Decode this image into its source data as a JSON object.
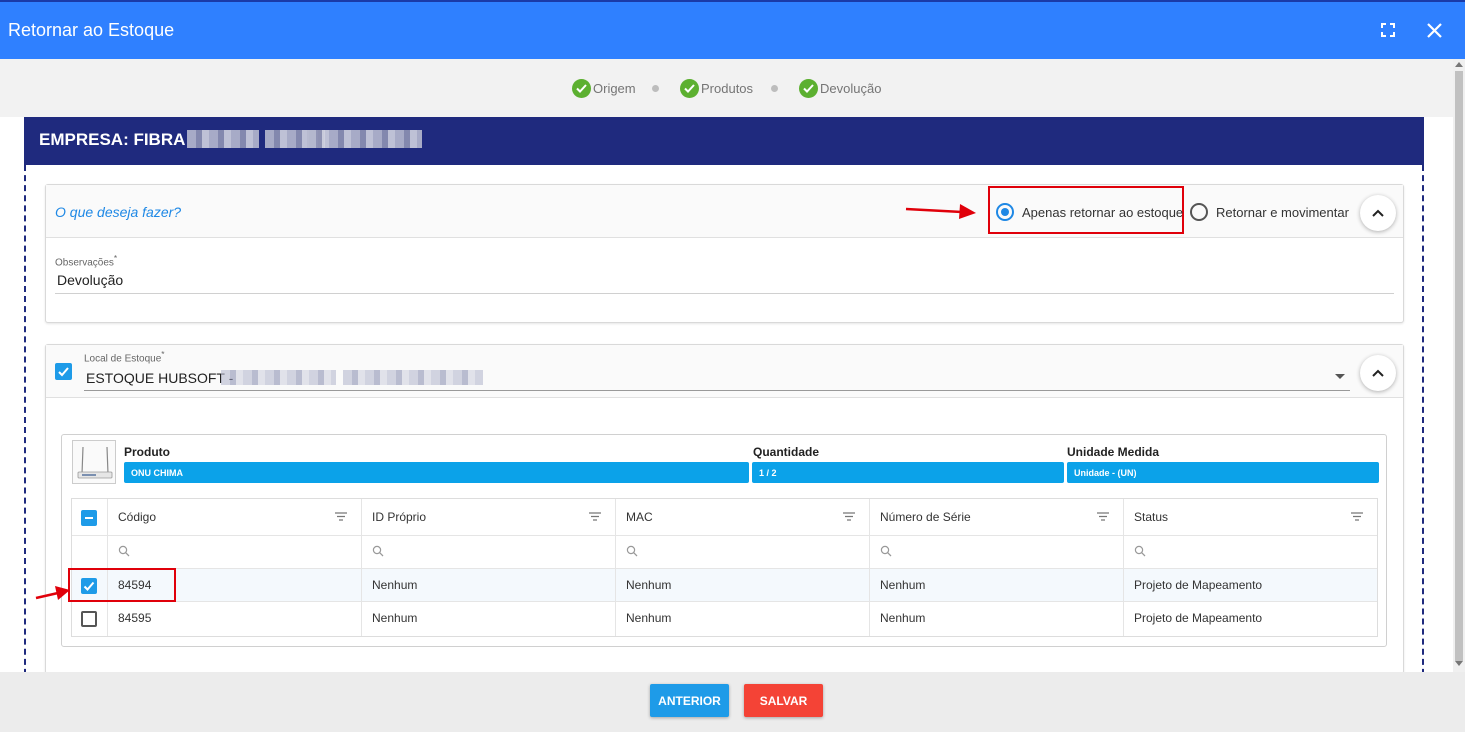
{
  "window": {
    "title": "Retornar ao Estoque",
    "accent": "#2f80ff"
  },
  "steps": [
    {
      "label": "Origem",
      "status": "done"
    },
    {
      "label": "Produtos",
      "status": "done"
    },
    {
      "label": "Devolução",
      "status": "done"
    }
  ],
  "company": {
    "label": "EMPRESA: FIBRA",
    "bar_color": "#1f2a7e"
  },
  "action_panel": {
    "question": "O que deseja fazer?",
    "options": [
      {
        "label": "Apenas retornar ao estoque",
        "selected": true
      },
      {
        "label": "Retornar e movimentar",
        "selected": false
      }
    ],
    "obs_label": "Observações",
    "obs_required": "*",
    "obs_value": "Devolução"
  },
  "stock_panel": {
    "checked": true,
    "label": "Local de Estoque",
    "required": "*",
    "value": "ESTOQUE HUBSOFT -"
  },
  "product": {
    "headers": {
      "product": "Produto",
      "qty": "Quantidade",
      "unit": "Unidade Medida"
    },
    "name": "ONU CHIMA",
    "qty": "1 / 2",
    "unit": "Unidade - (UN)"
  },
  "grid": {
    "columns": [
      "Código",
      "ID Próprio",
      "MAC",
      "Número de Série",
      "Status"
    ],
    "rows": [
      {
        "checked": true,
        "cells": [
          "84594",
          "Nenhum",
          "Nenhum",
          "Nenhum",
          "Projeto de Mapeamento"
        ]
      },
      {
        "checked": false,
        "cells": [
          "84595",
          "Nenhum",
          "Nenhum",
          "Nenhum",
          "Projeto de Mapeamento"
        ]
      }
    ]
  },
  "footer": {
    "prev_label": "ANTERIOR",
    "save_label": "SALVAR",
    "prev_color": "#1e9be8",
    "save_color": "#f44336"
  }
}
